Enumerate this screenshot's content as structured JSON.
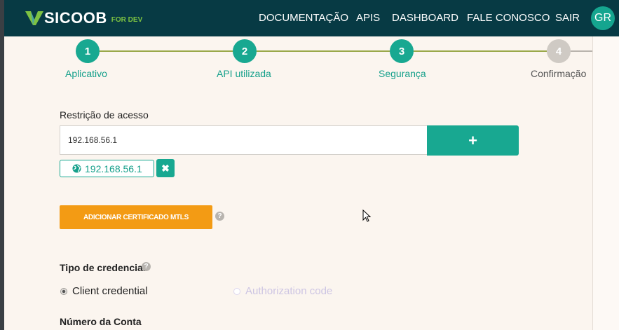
{
  "header": {
    "logo_text": "SICOOB",
    "logo_sub": "FOR DEV",
    "nav": [
      {
        "label": "DOCUMENTAÇÃO"
      },
      {
        "label": "APIS"
      },
      {
        "label": "DASHBOARD"
      },
      {
        "label": "FALE CONOSCO"
      },
      {
        "label": "SAIR"
      }
    ],
    "avatar_initials": "GR"
  },
  "stepper": {
    "current_step": 3,
    "steps": [
      {
        "number": "1",
        "label": "Aplicativo",
        "state": "done"
      },
      {
        "number": "2",
        "label": "API utilizada",
        "state": "done"
      },
      {
        "number": "3",
        "label": "Segurança",
        "state": "active"
      },
      {
        "number": "4",
        "label": "Confirmação",
        "state": "pending"
      }
    ]
  },
  "access_restriction": {
    "label": "Restrição de acesso",
    "input_value": "192.168.56.1",
    "add_button": "+",
    "tags": [
      {
        "value": "192.168.56.1",
        "icon": "globe-icon",
        "remove_icon": "close-icon",
        "remove_label": "✖"
      }
    ]
  },
  "mtls": {
    "button_label": "ADICIONAR CERTIFICADO MTLS",
    "help_icon": "question-circle-icon",
    "help_glyph": "?"
  },
  "credential": {
    "label": "Tipo de credencial",
    "help_glyph": "?",
    "options": [
      {
        "label": "Client credential",
        "checked": true,
        "disabled": false
      },
      {
        "label": "Authorization code",
        "checked": false,
        "disabled": true
      }
    ]
  },
  "account": {
    "label": "Número da Conta"
  },
  "colors": {
    "header_bg": "#073a44",
    "accent": "#18a891",
    "orange": "#f39b14",
    "step_line": "#9aa84a",
    "page_bg": "#fbf5ef"
  }
}
